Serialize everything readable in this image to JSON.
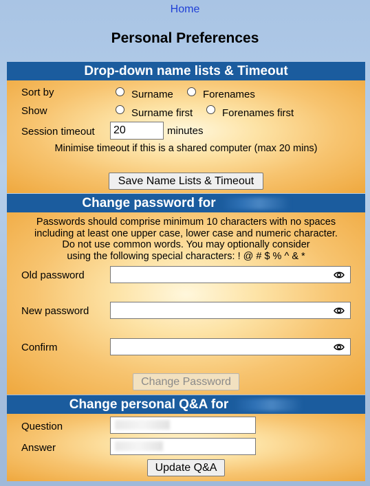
{
  "nav": {
    "home": "Home"
  },
  "page_title": "Personal Preferences",
  "dropdown_section": {
    "title": "Drop-down name lists & Timeout",
    "sort_by_label": "Sort by",
    "sort_options": [
      "Surname",
      "Forenames"
    ],
    "show_label": "Show",
    "show_options": [
      "Surname first",
      "Forenames first"
    ],
    "timeout_label": "Session timeout",
    "timeout_value": "20",
    "timeout_unit": "minutes",
    "timeout_note": "Minimise timeout if this is a shared computer (max 20 mins)",
    "save_button": "Save Name Lists & Timeout"
  },
  "password_section": {
    "title": "Change password for",
    "note_lines": [
      "Passwords should comprise minimum 10 characters with no spaces",
      "including at least one upper case, lower case and numeric character.",
      "Do not use common words. You may optionally consider",
      "using the following special characters: ! @ # $ % ^ & *"
    ],
    "old_label": "Old password",
    "new_label": "New password",
    "confirm_label": "Confirm",
    "change_button": "Change Password"
  },
  "qa_section": {
    "title": "Change personal Q&A for",
    "question_label": "Question",
    "answer_label": "Answer",
    "update_button": "Update Q&A"
  }
}
